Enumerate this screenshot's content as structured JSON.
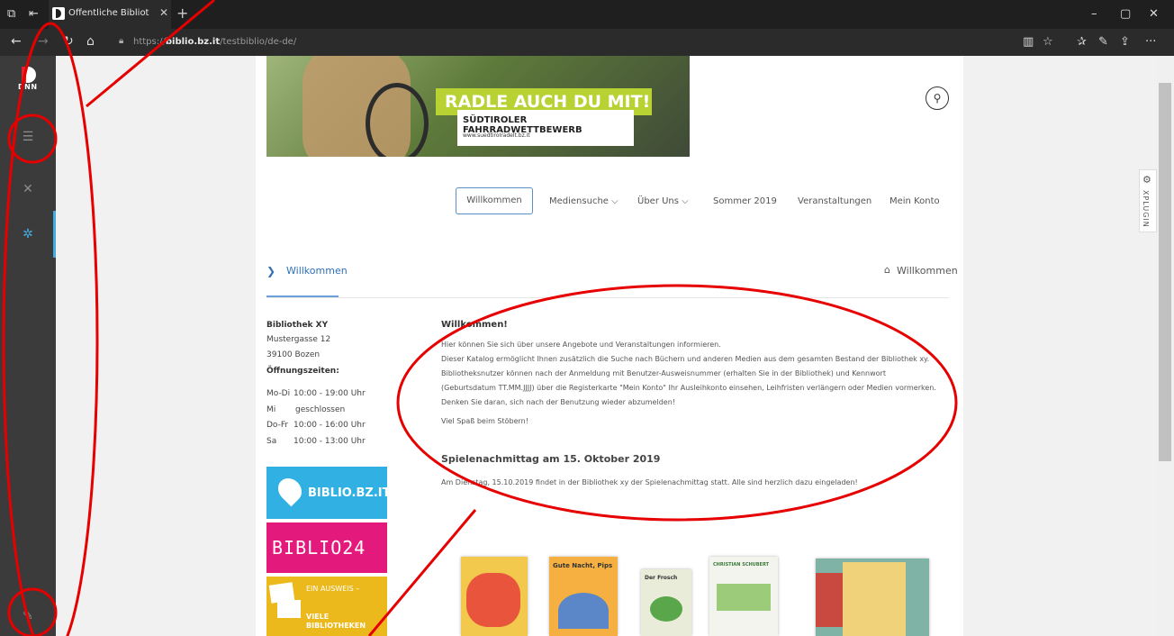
{
  "browser": {
    "tab_title": "Öffentliche Bibliothek N",
    "tab_close": "✕",
    "new_tab": "+",
    "url_prefix": "https://",
    "url_host": "biblio.bz.it",
    "url_path": "/testbiblio/de-de/",
    "back": "←",
    "forward": "→",
    "refresh": "↻",
    "home": "⌂",
    "minimize": "–",
    "maximize": "▢",
    "close": "✕",
    "more": "···"
  },
  "persona": {
    "logo_text": "DNN"
  },
  "site": {
    "banner_headline": "RADLE AUCH DU MIT!",
    "banner_sub": "SÜDTIROLER FAHRRADWETTBEWERB",
    "banner_url": "www.suedtirolradelt.bz.it",
    "menu": [
      "Willkommen",
      "Mediensuche ⌵",
      "Über Uns ⌵",
      "Sommer 2019",
      "Veranstaltungen",
      "Mein Konto"
    ],
    "breadcrumb": "Willkommen",
    "breadcrumb_right": "Willkommen",
    "xplugin_label": "XPLUGIN"
  },
  "library": {
    "name": "Bibliothek XY",
    "street": "Mustergasse 12",
    "city": "39100 Bozen",
    "hours_title": "Öffnungszeiten:",
    "hours": [
      {
        "day": "Mo-Di",
        "time": "10:00 - 19:00 Uhr"
      },
      {
        "day": "Mi",
        "time": "geschlossen"
      },
      {
        "day": "Do-Fr",
        "time": "10:00 - 16:00 Uhr"
      },
      {
        "day": "Sa",
        "time": "10:00 - 13:00 Uhr"
      }
    ],
    "logo1": "BIBLIO.BZ.IT",
    "logo2": "BIBLIO24",
    "logo3_top": "EIN AUSWEIS –",
    "logo3_bottom": "VIELE BIBLIOTHEKEN"
  },
  "main": {
    "welcome_title": "Willkommen!",
    "paragraphs": [
      "Hier können Sie sich über unsere Angebote und Veranstaltungen informieren.",
      "Dieser Katalog ermöglicht Ihnen zusätzlich die Suche nach Büchern und anderen Medien aus dem gesamten Bestand der Bibliothek xy.",
      "Bibliotheksnutzer können nach der Anmeldung mit Benutzer-Ausweisnummer (erhalten Sie in der Bibliothek) und Kennwort",
      "(Geburtsdatum TT.MM.JJJJ) über die Registerkarte \"Mein Konto\" Ihr Ausleihkonto einsehen, Leihfristen verlängern oder Medien vormerken.",
      "Denken Sie daran, sich nach der Benutzung wieder abzumelden!"
    ],
    "closing": "Viel Spaß beim Stöbern!",
    "event_title": "Spielenachmittag am 15. Oktober 2019",
    "event_text": "Am Dienstag, 15.10.2019 findet in der Bibliothek xy der Spielenachmittag statt. Alle sind herzlich dazu eingeladen!"
  },
  "books": [
    {
      "title": "",
      "color": "#f2c94c"
    },
    {
      "title": "Gute Nacht, Pips",
      "color": "#f5b041"
    },
    {
      "title": "Der Frosch",
      "color": "#e9ecd9"
    },
    {
      "title": "CHRISTIAN SCHUBERT",
      "color": "#f4f4ee"
    },
    {
      "title": "",
      "color": "#7fb3a6"
    }
  ],
  "colors": {
    "annotation": "#e60000",
    "accent": "#2f6fb7",
    "persona_bg": "#3b3b3b"
  }
}
